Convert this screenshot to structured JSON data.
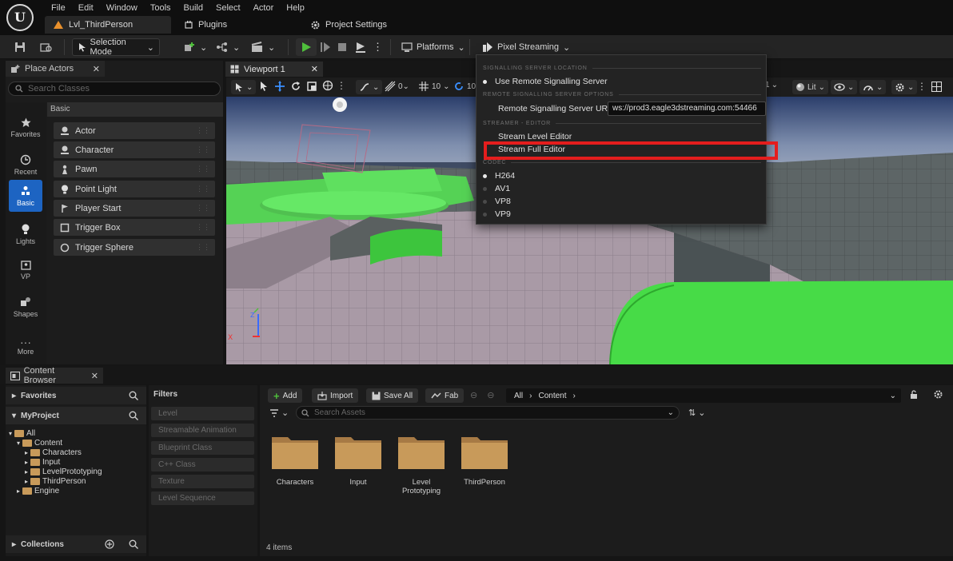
{
  "menubar": {
    "items": [
      "File",
      "Edit",
      "Window",
      "Tools",
      "Build",
      "Select",
      "Actor",
      "Help"
    ]
  },
  "doc_tabs": {
    "level": "Lvl_ThirdPerson",
    "plugins": "Plugins",
    "project_settings": "Project Settings"
  },
  "toolbar": {
    "selection_mode": "Selection Mode",
    "platforms": "Platforms",
    "pixel_streaming": "Pixel Streaming"
  },
  "place_actors": {
    "tab": "Place Actors",
    "search_placeholder": "Search Classes",
    "categories": [
      "Favorites",
      "Recent",
      "Basic",
      "Lights",
      "VP",
      "Shapes",
      "More"
    ],
    "section": "Basic",
    "items": [
      "Actor",
      "Character",
      "Pawn",
      "Point Light",
      "Player Start",
      "Trigger Box",
      "Trigger Sphere"
    ]
  },
  "viewport": {
    "tab": "Viewport 1",
    "grid_snap": "10",
    "rot_snap": "10",
    "camera_speed_partial": "1",
    "view_mode": "Lit"
  },
  "ps_menu": {
    "section_location": "SIGNALLING SERVER LOCATION",
    "use_remote": "Use Remote Signalling Server",
    "section_remote": "REMOTE SIGNALLING SERVER OPTIONS",
    "url_label": "Remote Signalling Server URL",
    "url_value": "ws://prod3.eagle3dstreaming.com:54466",
    "section_streamer": "STREAMER - EDITOR",
    "stream_level": "Stream Level Editor",
    "stream_full": "Stream Full Editor",
    "section_codec": "CODEC",
    "codecs": [
      "H264",
      "AV1",
      "VP8",
      "VP9"
    ]
  },
  "content_browser": {
    "tab": "Content Browser",
    "favorites": "Favorites",
    "project": "MyProject",
    "tree": [
      "All",
      "Content",
      "Characters",
      "Input",
      "LevelPrototyping",
      "ThirdPerson",
      "Engine"
    ],
    "collections": "Collections",
    "filters_title": "Filters",
    "filters": [
      "Level",
      "Streamable Animation",
      "Blueprint Class",
      "C++ Class",
      "Texture",
      "Level Sequence"
    ],
    "add": "Add",
    "import": "Import",
    "save_all": "Save All",
    "fab": "Fab",
    "path": [
      "All",
      "Content"
    ],
    "search_placeholder": "Search Assets",
    "folders": [
      "Characters",
      "Input",
      "Level\nPrototyping",
      "ThirdPerson"
    ],
    "count": "4 items"
  },
  "colors": {
    "accent": "#1d64c2",
    "highlight": "#e41d1d",
    "play_green": "#4fbf3c",
    "folder": "#c89a5a"
  }
}
